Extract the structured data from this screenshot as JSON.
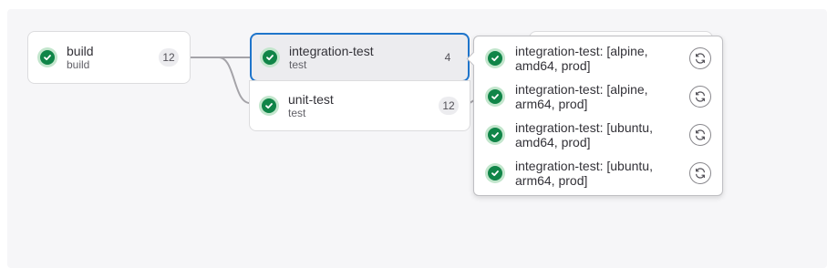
{
  "colors": {
    "success": "#108548",
    "success_ring": "#c3e6cd",
    "active_border": "#1f75cb",
    "canvas": "#f6f6f8"
  },
  "jobs": [
    {
      "name": "build",
      "stage": "build",
      "count": "12",
      "status": "success",
      "icon": "status-success-icon"
    },
    {
      "name": "integration-test",
      "stage": "test",
      "count": "4",
      "status": "success",
      "icon": "status-success-icon",
      "active": true
    },
    {
      "name": "unit-test",
      "stage": "test",
      "count": "12",
      "status": "success",
      "icon": "status-success-icon"
    }
  ],
  "dropdown": {
    "items": [
      {
        "name": "integration-test: [alpine, amd64, prod]",
        "status": "success",
        "action_icon": "retry-icon"
      },
      {
        "name": "integration-test: [alpine, arm64, prod]",
        "status": "success",
        "action_icon": "retry-icon"
      },
      {
        "name": "integration-test: [ubuntu, amd64, prod]",
        "status": "success",
        "action_icon": "retry-icon"
      },
      {
        "name": "integration-test: [ubuntu, arm64, prod]",
        "status": "success",
        "action_icon": "retry-icon"
      }
    ]
  }
}
